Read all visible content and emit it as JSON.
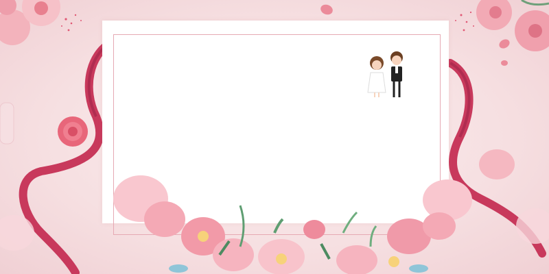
{
  "scene": {
    "colors": {
      "background": "#f6dfe1",
      "ribbon": "#c8395c",
      "ribbon_shadow": "#9e2447",
      "rose": "#e8667a",
      "card": "#ffffff",
      "card_border": "#e6a9b3",
      "peony": "#f4a9b5",
      "leaf": "#5f9e72"
    },
    "icons": [
      "wedding-couple-icon",
      "rose-icon",
      "ribbon-left",
      "ribbon-right",
      "peony-bouquet",
      "heart-petal"
    ]
  }
}
